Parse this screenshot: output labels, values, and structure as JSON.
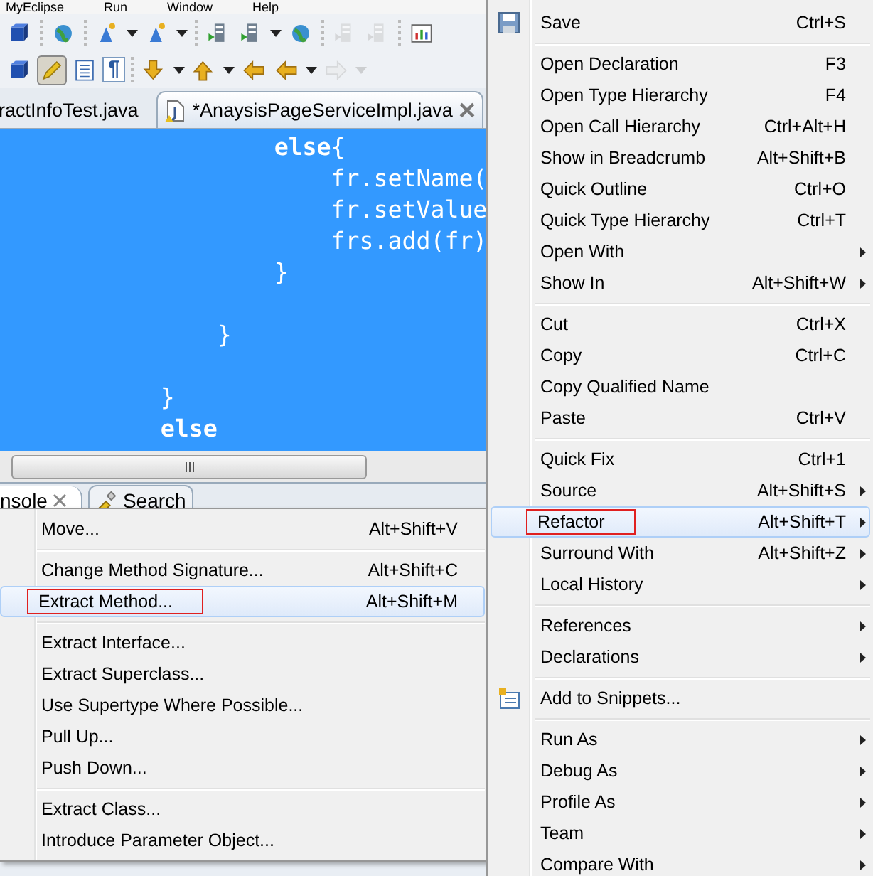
{
  "menubar": [
    "MyEclipse",
    "Run",
    "Window",
    "Help"
  ],
  "toolbar_rows": [
    [
      [
        {
          "kind": "cube",
          "disabled": false,
          "pressed": false
        }
      ],
      [
        {
          "kind": "globe",
          "disabled": false,
          "pressed": false
        }
      ],
      [
        {
          "kind": "wizard",
          "disabled": false,
          "pressed": false
        },
        {
          "kind": "caret",
          "disabled": false,
          "pressed": false
        },
        {
          "kind": "wizard",
          "disabled": false,
          "pressed": false
        },
        {
          "kind": "caret",
          "disabled": false,
          "pressed": false
        }
      ],
      [
        {
          "kind": "server",
          "disabled": false,
          "pressed": false
        },
        {
          "kind": "server",
          "disabled": false,
          "pressed": false
        },
        {
          "kind": "caret",
          "disabled": false,
          "pressed": false
        },
        {
          "kind": "globe",
          "disabled": false,
          "pressed": false
        }
      ],
      [
        {
          "kind": "server",
          "disabled": true,
          "pressed": false
        },
        {
          "kind": "server",
          "disabled": true,
          "pressed": false
        }
      ],
      [
        {
          "kind": "chart",
          "disabled": false,
          "pressed": false
        }
      ]
    ],
    [
      [
        {
          "kind": "cube",
          "disabled": false,
          "pressed": false
        },
        {
          "kind": "pencil",
          "disabled": false,
          "pressed": true
        },
        {
          "kind": "list",
          "disabled": false,
          "pressed": false
        },
        {
          "kind": "pilcrow",
          "label": "¶",
          "disabled": false,
          "pressed": false
        }
      ],
      [
        {
          "kind": "arrow-down",
          "disabled": false,
          "pressed": false
        },
        {
          "kind": "caret",
          "disabled": false,
          "pressed": false
        },
        {
          "kind": "arrow-up",
          "disabled": false,
          "pressed": false
        },
        {
          "kind": "caret",
          "disabled": false,
          "pressed": false
        },
        {
          "kind": "arrow-left",
          "disabled": false,
          "pressed": false
        },
        {
          "kind": "arrow-left",
          "disabled": false,
          "pressed": false
        },
        {
          "kind": "caret",
          "disabled": false,
          "pressed": false
        },
        {
          "kind": "arrow-right",
          "disabled": true,
          "pressed": false
        },
        {
          "kind": "caret",
          "disabled": true,
          "pressed": false
        }
      ]
    ]
  ],
  "editor_tabs": [
    {
      "label": "ractInfoTest.java",
      "selected": false,
      "closable": false
    },
    {
      "label": "*AnaysisPageServiceImpl.java",
      "selected": true,
      "closable": true
    }
  ],
  "code_lines": [
    {
      "text": "                   **else**{",
      "bold": false,
      "blank_before": false
    },
    {
      "text": "                       fr.setName(",
      "bold": false,
      "blank_before": false
    },
    {
      "text": "                       fr.setValue",
      "bold": false,
      "blank_before": false
    },
    {
      "text": "                       frs.add(fr)",
      "bold": false,
      "blank_before": false
    },
    {
      "text": "                   }",
      "bold": false,
      "blank_before": false
    },
    {
      "text": "               }",
      "bold": false,
      "blank_before": true
    },
    {
      "text": "           }",
      "bold": false,
      "blank_before": true
    },
    {
      "text": "           else",
      "bold": true,
      "blank_before": false
    }
  ],
  "panel_tabs": [
    {
      "label": "nsole",
      "selected": true,
      "closable": true
    },
    {
      "label": "Search",
      "selected": false,
      "closable": false
    }
  ],
  "context_menu": {
    "groups": [
      [
        {
          "label": "Save",
          "shortcut": "Ctrl+S",
          "kind": "save",
          "submenu": false,
          "selected": false,
          "marked": false
        }
      ],
      [
        {
          "label": "Open Declaration",
          "shortcut": "F3",
          "kind": "plain",
          "submenu": false,
          "selected": false,
          "marked": false
        },
        {
          "label": "Open Type Hierarchy",
          "shortcut": "F4",
          "kind": "plain",
          "submenu": false,
          "selected": false,
          "marked": false
        },
        {
          "label": "Open Call Hierarchy",
          "shortcut": "Ctrl+Alt+H",
          "kind": "plain",
          "submenu": false,
          "selected": false,
          "marked": false
        },
        {
          "label": "Show in Breadcrumb",
          "shortcut": "Alt+Shift+B",
          "kind": "plain",
          "submenu": false,
          "selected": false,
          "marked": false
        },
        {
          "label": "Quick Outline",
          "shortcut": "Ctrl+O",
          "kind": "plain",
          "submenu": false,
          "selected": false,
          "marked": false
        },
        {
          "label": "Quick Type Hierarchy",
          "shortcut": "Ctrl+T",
          "kind": "plain",
          "submenu": false,
          "selected": false,
          "marked": false
        },
        {
          "label": "Open With",
          "kind": "plain",
          "submenu": true,
          "selected": false,
          "marked": false
        },
        {
          "label": "Show In",
          "shortcut": "Alt+Shift+W",
          "kind": "plain",
          "submenu": true,
          "selected": false,
          "marked": false
        }
      ],
      [
        {
          "label": "Cut",
          "shortcut": "Ctrl+X",
          "kind": "plain",
          "submenu": false,
          "selected": false,
          "marked": false
        },
        {
          "label": "Copy",
          "shortcut": "Ctrl+C",
          "kind": "plain",
          "submenu": false,
          "selected": false,
          "marked": false
        },
        {
          "label": "Copy Qualified Name",
          "kind": "plain",
          "submenu": false,
          "selected": false,
          "marked": false
        },
        {
          "label": "Paste",
          "shortcut": "Ctrl+V",
          "kind": "plain",
          "submenu": false,
          "selected": false,
          "marked": false
        }
      ],
      [
        {
          "label": "Quick Fix",
          "shortcut": "Ctrl+1",
          "kind": "plain",
          "submenu": false,
          "selected": false,
          "marked": false
        },
        {
          "label": "Source",
          "shortcut": "Alt+Shift+S",
          "kind": "plain",
          "submenu": true,
          "selected": false,
          "marked": false
        },
        {
          "label": "Refactor",
          "shortcut": "Alt+Shift+T",
          "kind": "plain",
          "submenu": true,
          "selected": true,
          "marked": true
        },
        {
          "label": "Surround With",
          "shortcut": "Alt+Shift+Z",
          "kind": "plain",
          "submenu": true,
          "selected": false,
          "marked": false
        },
        {
          "label": "Local History",
          "kind": "plain",
          "submenu": true,
          "selected": false,
          "marked": false
        }
      ],
      [
        {
          "label": "References",
          "kind": "plain",
          "submenu": true,
          "selected": false,
          "marked": false
        },
        {
          "label": "Declarations",
          "kind": "plain",
          "submenu": true,
          "selected": false,
          "marked": false
        }
      ],
      [
        {
          "label": "Add to Snippets...",
          "kind": "snippet",
          "submenu": false,
          "selected": false,
          "marked": false
        }
      ],
      [
        {
          "label": "Run As",
          "kind": "plain",
          "submenu": true,
          "selected": false,
          "marked": false
        },
        {
          "label": "Debug As",
          "kind": "plain",
          "submenu": true,
          "selected": false,
          "marked": false
        },
        {
          "label": "Profile As",
          "kind": "plain",
          "submenu": true,
          "selected": false,
          "marked": false
        },
        {
          "label": "Team",
          "kind": "plain",
          "submenu": true,
          "selected": false,
          "marked": false
        },
        {
          "label": "Compare With",
          "kind": "plain",
          "submenu": true,
          "selected": false,
          "marked": false
        }
      ]
    ]
  },
  "refactor_submenu": {
    "groups": [
      [
        {
          "label": "Move...",
          "shortcut": "Alt+Shift+V",
          "selected": false,
          "marked": false
        }
      ],
      [
        {
          "label": "Change Method Signature...",
          "shortcut": "Alt+Shift+C",
          "selected": false,
          "marked": false
        },
        {
          "label": "Extract Method...",
          "shortcut": "Alt+Shift+M",
          "selected": true,
          "marked": true
        }
      ],
      [
        {
          "label": "Extract Interface...",
          "selected": false,
          "marked": false
        },
        {
          "label": "Extract Superclass...",
          "selected": false,
          "marked": false
        },
        {
          "label": "Use Supertype Where Possible...",
          "selected": false,
          "marked": false
        },
        {
          "label": "Pull Up...",
          "selected": false,
          "marked": false
        },
        {
          "label": "Push Down...",
          "selected": false,
          "marked": false
        }
      ],
      [
        {
          "label": "Extract Class...",
          "selected": false,
          "marked": false
        },
        {
          "label": "Introduce Parameter Object...",
          "selected": false,
          "marked": false
        }
      ]
    ]
  }
}
